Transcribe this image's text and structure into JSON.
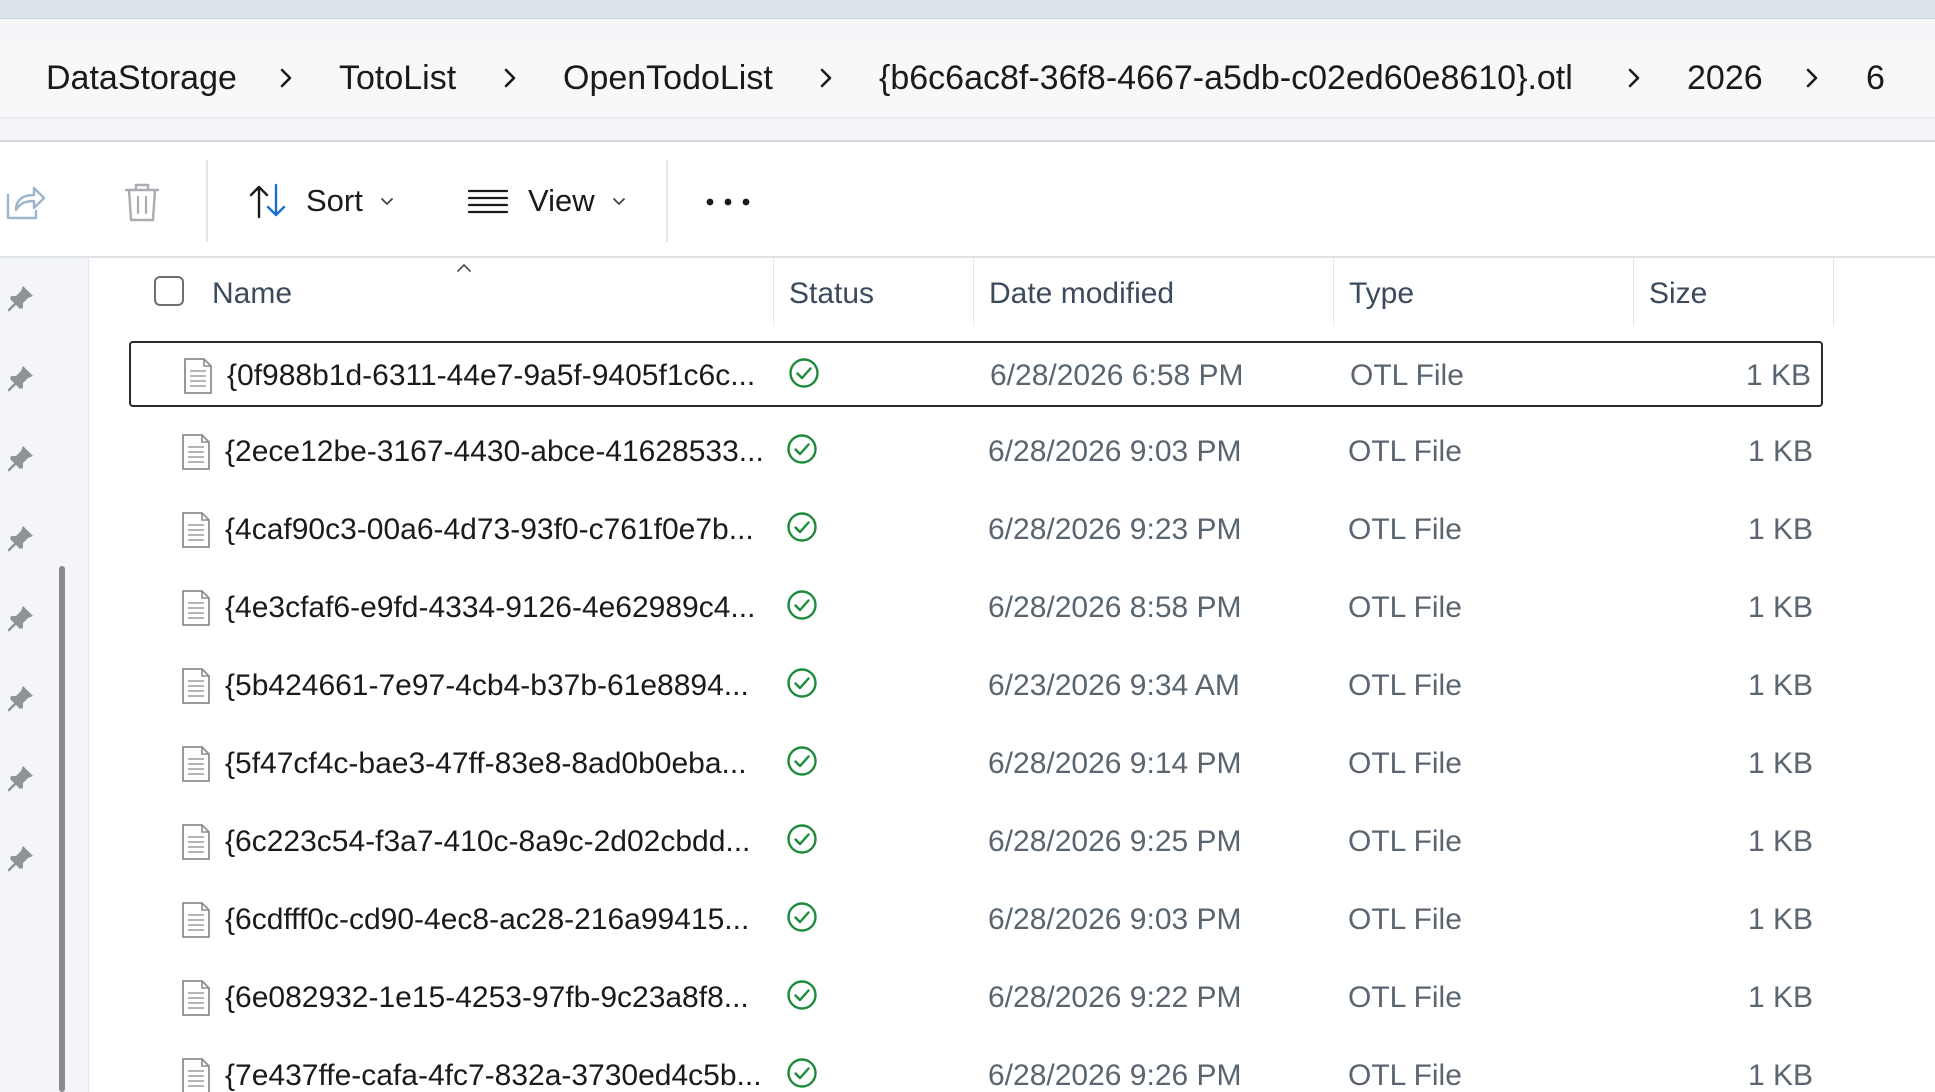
{
  "breadcrumb": [
    {
      "label": "DataStorage"
    },
    {
      "label": "TotoList"
    },
    {
      "label": "OpenTodoList"
    },
    {
      "label": "{b6c6ac8f-36f8-4667-a5db-c02ed60e8610}.otl"
    },
    {
      "label": "2026"
    },
    {
      "label": "6"
    }
  ],
  "toolbar": {
    "share_icon": "share-icon",
    "delete_icon": "trash-icon",
    "sort_label": "Sort",
    "view_label": "View",
    "more_icon": "more-dots-icon"
  },
  "sidebar": {
    "pins": [
      "pin-icon",
      "pin-icon",
      "pin-icon",
      "pin-icon",
      "pin-icon",
      "pin-icon",
      "pin-icon",
      "pin-icon"
    ]
  },
  "columns": {
    "name": "Name",
    "status": "Status",
    "date_modified": "Date modified",
    "type": "Type",
    "size": "Size"
  },
  "files": [
    {
      "name": "{0f988b1d-6311-44e7-9a5f-9405f1c6c...",
      "status": "synced",
      "date": "6/28/2026 6:58 PM",
      "type": "OTL File",
      "size": "1 KB",
      "selected": true
    },
    {
      "name": "{2ece12be-3167-4430-abce-41628533...",
      "status": "synced",
      "date": "6/28/2026 9:03 PM",
      "type": "OTL File",
      "size": "1 KB"
    },
    {
      "name": "{4caf90c3-00a6-4d73-93f0-c761f0e7b...",
      "status": "synced",
      "date": "6/28/2026 9:23 PM",
      "type": "OTL File",
      "size": "1 KB"
    },
    {
      "name": "{4e3cfaf6-e9fd-4334-9126-4e62989c4...",
      "status": "synced",
      "date": "6/28/2026 8:58 PM",
      "type": "OTL File",
      "size": "1 KB"
    },
    {
      "name": "{5b424661-7e97-4cb4-b37b-61e8894...",
      "status": "synced",
      "date": "6/23/2026 9:34 AM",
      "type": "OTL File",
      "size": "1 KB"
    },
    {
      "name": "{5f47cf4c-bae3-47ff-83e8-8ad0b0eba...",
      "status": "synced",
      "date": "6/28/2026 9:14 PM",
      "type": "OTL File",
      "size": "1 KB"
    },
    {
      "name": "{6c223c54-f3a7-410c-8a9c-2d02cbdd...",
      "status": "synced",
      "date": "6/28/2026 9:25 PM",
      "type": "OTL File",
      "size": "1 KB"
    },
    {
      "name": "{6cdfff0c-cd90-4ec8-ac28-216a99415...",
      "status": "synced",
      "date": "6/28/2026 9:03 PM",
      "type": "OTL File",
      "size": "1 KB"
    },
    {
      "name": "{6e082932-1e15-4253-97fb-9c23a8f8...",
      "status": "synced",
      "date": "6/28/2026 9:22 PM",
      "type": "OTL File",
      "size": "1 KB"
    },
    {
      "name": "{7e437ffe-cafa-4fc7-832a-3730ed4c5b...",
      "status": "synced",
      "date": "6/28/2026 9:26 PM",
      "type": "OTL File",
      "size": "1 KB"
    }
  ],
  "colors": {
    "status_ok": "#1e8a3c",
    "accent_blue": "#1a6fd0"
  }
}
